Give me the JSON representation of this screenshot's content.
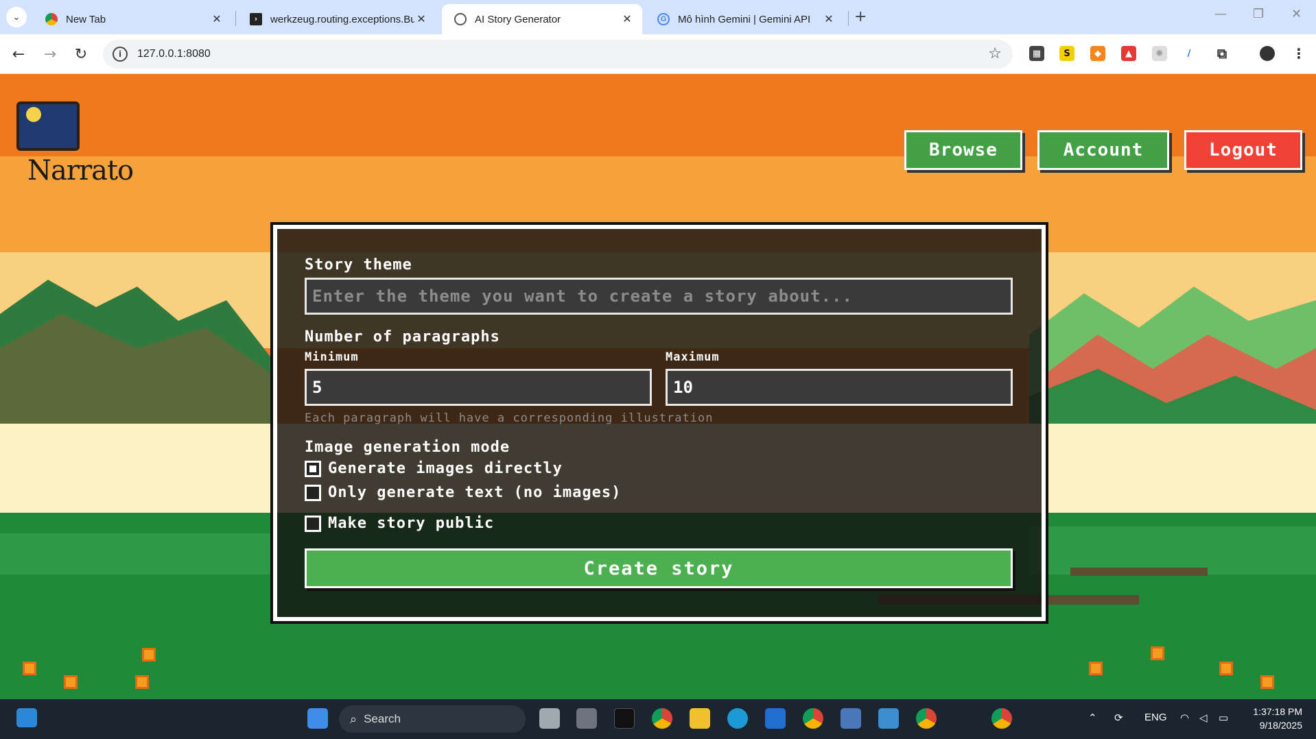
{
  "browser": {
    "tabs": [
      {
        "title": "New Tab",
        "icon": "chrome-icon"
      },
      {
        "title": "werkzeug.routing.exceptions.Bu",
        "icon": "terminal-icon"
      },
      {
        "title": "AI Story Generator",
        "icon": "globe-icon"
      },
      {
        "title": "Mô hình Gemini  |  Gemini API",
        "icon": "google-icon"
      }
    ],
    "url": "127.0.0.1:8080"
  },
  "app": {
    "logo_text": "Narrato",
    "nav": {
      "browse": "Browse",
      "account": "Account",
      "logout": "Logout"
    },
    "colors": {
      "green": "#43a047",
      "red": "#ef4136"
    }
  },
  "form": {
    "theme_label": "Story theme",
    "theme_placeholder": "Enter the theme you want to create a story about...",
    "paragraphs_label": "Number of paragraphs",
    "min_label": "Minimum",
    "min_value": "5",
    "max_label": "Maximum",
    "max_value": "10",
    "hint": "Each paragraph will have a corresponding illustration",
    "image_mode_label": "Image generation mode",
    "option_direct": "Generate images directly",
    "option_direct_checked": true,
    "option_text_only": "Only generate text (no images)",
    "option_text_only_checked": false,
    "public_label": "Make story public",
    "public_checked": false,
    "create_button": "Create story"
  },
  "taskbar": {
    "search": "Search",
    "lang": "ENG",
    "time": "1:37:18 PM",
    "date": "9/18/2025"
  }
}
